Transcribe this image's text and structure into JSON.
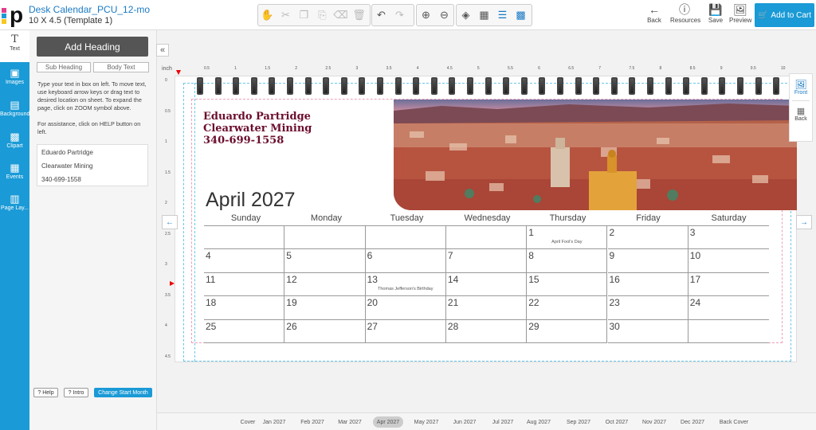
{
  "app": {
    "title": "Desk Calendar_PCU_12-mo",
    "subtitle": "10 X 4.5 (Template 1)",
    "logo_text": "p"
  },
  "toolbar": {
    "groups": [
      [
        "hand-icon",
        "cut-icon",
        "copy-icon",
        "paste-icon",
        "clear-icon",
        "delete-icon"
      ],
      [
        "undo-icon",
        "redo-icon"
      ],
      [
        "zoom-in-icon",
        "zoom-out-icon"
      ],
      [
        "layers-icon",
        "grid-icon",
        "align-icon",
        "guides-icon"
      ]
    ],
    "back_label": "Back",
    "resources_label": "Resources",
    "save_label": "Save",
    "preview_label": "Preview",
    "cart_label": "Add to Cart",
    "accent": "#1a9ad6"
  },
  "rail": [
    {
      "label": "Text",
      "icon": "text-icon",
      "active": true
    },
    {
      "label": "Images",
      "icon": "image-icon"
    },
    {
      "label": "Background",
      "icon": "background-icon"
    },
    {
      "label": "Clipart",
      "icon": "clipart-icon"
    },
    {
      "label": "Events",
      "icon": "calendar-icon"
    },
    {
      "label": "Page Lay...",
      "icon": "layout-icon"
    }
  ],
  "text_panel": {
    "add_heading": "Add Heading",
    "sub_heading": "Sub Heading",
    "body_text": "Body Text",
    "help1": "Type your text in box on left. To move text, use keyboard arrow keys or drag text to desired location on sheet. To expand the page, click on ZOOM symbol above.",
    "help2": "For assistance, click on HELP button on left.",
    "lines": [
      "Eduardo Partridge",
      "Clearwater Mining",
      "340-699-1558"
    ]
  },
  "bottom_buttons": {
    "help": "Help",
    "intro": "Intro",
    "change_start": "Change Start Month"
  },
  "ruler": {
    "unit": "inch",
    "h_ticks": [
      "0.5",
      "1",
      "1.5",
      "2",
      "2.5",
      "3",
      "3.5",
      "4",
      "4.5",
      "5",
      "5.5",
      "6",
      "6.5",
      "7",
      "7.5",
      "8",
      "8.5",
      "9",
      "9.5",
      "10"
    ],
    "v_ticks": [
      "0",
      "0.5",
      "1",
      "1.5",
      "2",
      "2.5",
      "3",
      "3.5",
      "4",
      "4.5"
    ]
  },
  "calendar": {
    "address": [
      "Eduardo Partridge",
      "Clearwater Mining",
      "340-699-1558"
    ],
    "month_title": "April 2027",
    "days": [
      "Sunday",
      "Monday",
      "Tuesday",
      "Wednesday",
      "Thursday",
      "Friday",
      "Saturday"
    ],
    "weeks": [
      [
        "",
        "",
        "",
        "",
        "1",
        "2",
        "3"
      ],
      [
        "4",
        "5",
        "6",
        "7",
        "8",
        "9",
        "10"
      ],
      [
        "11",
        "12",
        "13",
        "14",
        "15",
        "16",
        "17"
      ],
      [
        "18",
        "19",
        "20",
        "21",
        "22",
        "23",
        "24"
      ],
      [
        "25",
        "26",
        "27",
        "28",
        "29",
        "30",
        ""
      ]
    ],
    "events": [
      {
        "week": 0,
        "day": 4,
        "text": "April Fool's Day"
      },
      {
        "week": 2,
        "day": 2,
        "text": "Thomas Jefferson's Birthday"
      }
    ]
  },
  "sidetab": {
    "front": "Front",
    "back": "Back"
  },
  "months": [
    "Cover",
    "Jan 2027",
    "Feb 2027",
    "Mar 2027",
    "Apr 2027",
    "May 2027",
    "Jun 2027",
    "Jul 2027",
    "Aug 2027",
    "Sep 2027",
    "Oct 2027",
    "Nov 2027",
    "Dec 2027",
    "Back Cover"
  ],
  "active_month": "Apr 2027"
}
